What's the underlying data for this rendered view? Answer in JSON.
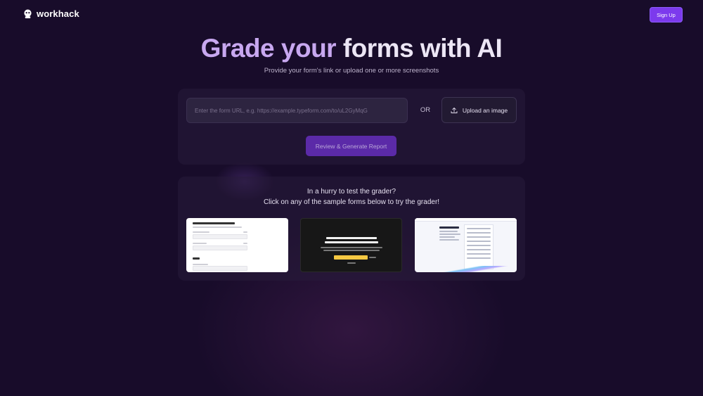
{
  "nav": {
    "logo_text": "workhack",
    "signup_label": "Sign Up"
  },
  "hero": {
    "title_part1": "Grade your",
    "title_part2": "forms with AI",
    "subtitle": "Provide your form's link or upload one or more screenshots"
  },
  "url_form": {
    "placeholder": "Enter the form URL, e.g. https://example.typeform.com/to/uL2GyMqG",
    "value": "",
    "or_label": "OR",
    "upload_label": "Upload an image",
    "review_label": "Review & Generate Report"
  },
  "samples": {
    "line1": "In a hurry to test the grader?",
    "line2": "Click on any of the sample forms below to try the grader!",
    "items": [
      {
        "icon": "form-thumbnail",
        "heading": "Tell us more about this product"
      },
      {
        "icon": "form-thumbnail",
        "heading": "Smart Move! Welcome to the ProductLed Community! ⚡"
      },
      {
        "icon": "form-thumbnail",
        "heading": "Speak to an expert"
      }
    ]
  },
  "colors": {
    "background": "#180c2a",
    "accent": "#7c3aed",
    "title_gradient_start": "#c8a8f0",
    "title_gradient_end": "#ece6f5"
  }
}
